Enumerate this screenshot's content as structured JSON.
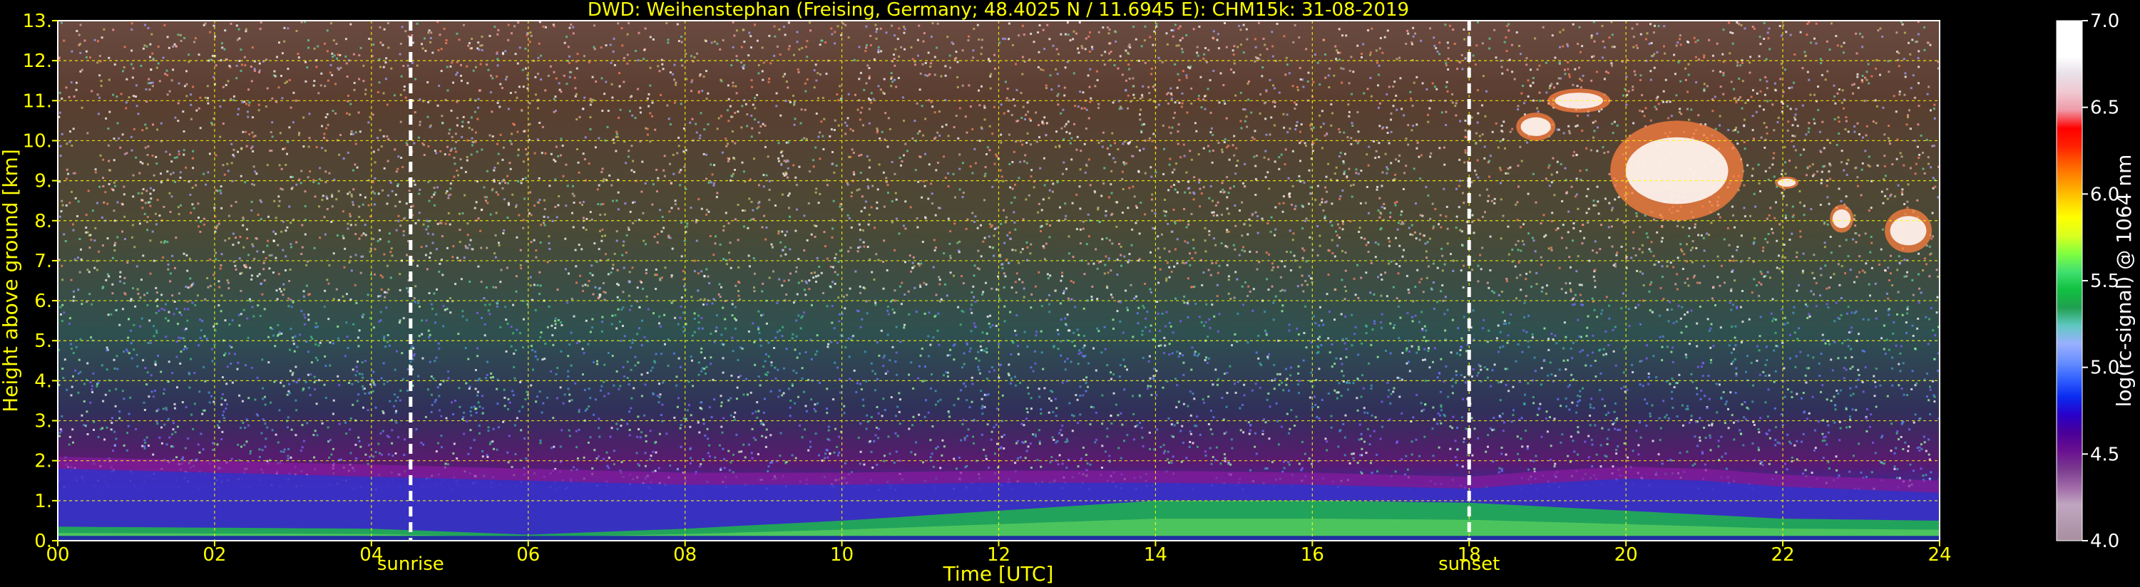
{
  "chart_data": {
    "type": "heatmap",
    "title": "DWD: Weihenstephan (Freising, Germany; 48.4025 N / 11.6945 E):    CHM15k: 31-08-2019",
    "xlabel": "Time [UTC]",
    "ylabel": "Height above ground [km]",
    "xlim": [
      0,
      24
    ],
    "ylim": [
      0,
      13
    ],
    "x_ticks": [
      0,
      2,
      4,
      6,
      8,
      10,
      12,
      14,
      16,
      18,
      20,
      22,
      24
    ],
    "x_tick_labels": [
      "00",
      "02",
      "04",
      "06",
      "08",
      "10",
      "12",
      "14",
      "16",
      "18",
      "20",
      "22",
      "24"
    ],
    "y_ticks": [
      0,
      1,
      2,
      3,
      4,
      5,
      6,
      7,
      8,
      9,
      10,
      11,
      12,
      13
    ],
    "y_tick_labels": [
      "0.",
      "1.",
      "2.",
      "3.",
      "4.",
      "5.",
      "6.",
      "7.",
      "8.",
      "9.",
      "10.",
      "11.",
      "12.",
      "13."
    ],
    "grid": true,
    "markers": [
      {
        "label": "sunrise",
        "time": 4.5
      },
      {
        "label": "sunset",
        "time": 18.0
      }
    ],
    "colorbar": {
      "label": "log(rc-signal) @ 1064 nm",
      "range": [
        4.0,
        7.0
      ],
      "ticks": [
        4.0,
        4.5,
        5.0,
        5.5,
        6.0,
        6.5,
        7.0
      ],
      "tick_labels": [
        "4.0",
        "4.5",
        "5.0",
        "5.5",
        "6.0",
        "6.5",
        "7.0"
      ],
      "colors": [
        "#a88fa0",
        "#b499b0",
        "#c0a6c0",
        "#a06aa8",
        "#7a3a8f",
        "#6a1090",
        "#4a0098",
        "#2a00c8",
        "#0a2af0",
        "#3060ff",
        "#6a90ff",
        "#9ab0ff",
        "#60c8c0",
        "#20a050",
        "#10c040",
        "#40e070",
        "#80ff40",
        "#d8ff20",
        "#ffff00",
        "#ffd000",
        "#ff9800",
        "#ff6000",
        "#ff2000",
        "#ff0000",
        "#ef9aa8",
        "#f0c8d0",
        "#e8e0e8",
        "#ffffff",
        "#ffffff",
        "#ffffff"
      ]
    },
    "boundary_layer_top_km": [
      [
        0,
        1.8
      ],
      [
        2,
        1.7
      ],
      [
        4,
        1.6
      ],
      [
        6,
        1.5
      ],
      [
        8,
        1.4
      ],
      [
        10,
        1.4
      ],
      [
        12,
        1.45
      ],
      [
        14,
        1.45
      ],
      [
        16,
        1.4
      ],
      [
        18,
        1.3
      ],
      [
        19,
        1.45
      ],
      [
        20,
        1.55
      ],
      [
        21,
        1.5
      ],
      [
        22,
        1.35
      ],
      [
        24,
        1.2
      ]
    ],
    "mixing_layer_top_km": [
      [
        0,
        0.35
      ],
      [
        4,
        0.3
      ],
      [
        6,
        0.15
      ],
      [
        8,
        0.3
      ],
      [
        10,
        0.5
      ],
      [
        12,
        0.75
      ],
      [
        14,
        1.0
      ],
      [
        16,
        1.0
      ],
      [
        18,
        0.95
      ],
      [
        20,
        0.75
      ],
      [
        22,
        0.55
      ],
      [
        24,
        0.5
      ]
    ],
    "cirrus_clouds": [
      {
        "t_start": 18.6,
        "t_end": 19.1,
        "h_bottom": 10.0,
        "h_top": 10.7
      },
      {
        "t_start": 19.0,
        "t_end": 19.8,
        "h_bottom": 10.7,
        "h_top": 11.3
      },
      {
        "t_start": 19.8,
        "t_end": 21.5,
        "h_bottom": 8.0,
        "h_top": 10.5
      },
      {
        "t_start": 21.9,
        "t_end": 22.2,
        "h_bottom": 8.8,
        "h_top": 9.1
      },
      {
        "t_start": 22.6,
        "t_end": 22.9,
        "h_bottom": 7.7,
        "h_top": 8.4
      },
      {
        "t_start": 23.3,
        "t_end": 23.9,
        "h_bottom": 7.2,
        "h_top": 8.3
      }
    ]
  }
}
